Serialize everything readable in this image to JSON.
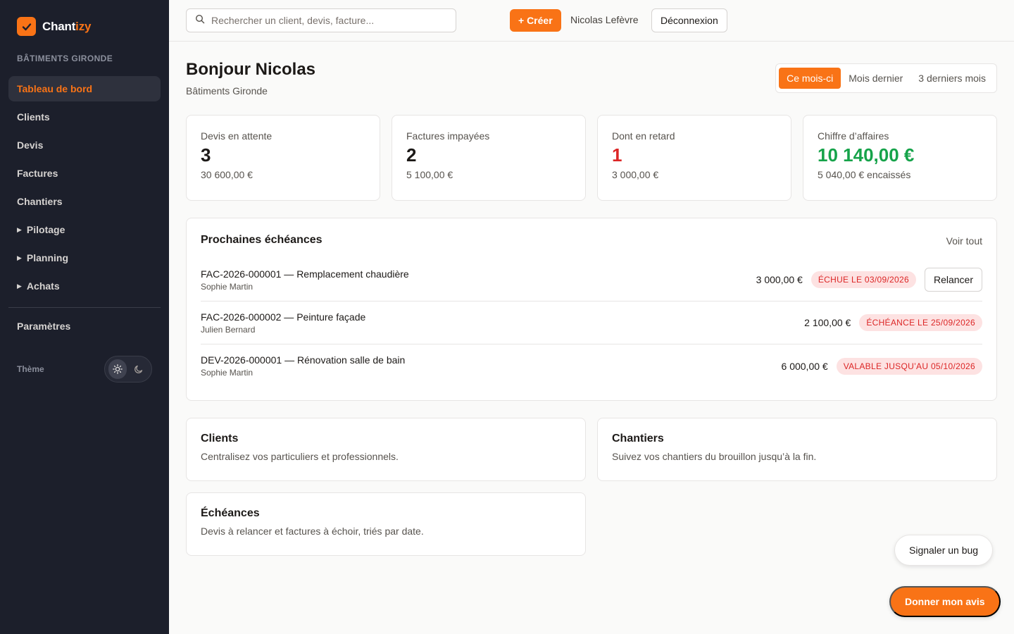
{
  "app": {
    "name_part1": "Chant",
    "name_part2": "izy",
    "brand_color": "#f97316"
  },
  "sidebar": {
    "company": "BÂTIMENTS GIRONDE",
    "items": [
      {
        "label": "Tableau de bord",
        "active": true
      },
      {
        "label": "Clients"
      },
      {
        "label": "Devis"
      },
      {
        "label": "Factures"
      },
      {
        "label": "Chantiers"
      },
      {
        "label": "Pilotage",
        "expandable": true
      },
      {
        "label": "Planning",
        "expandable": true
      },
      {
        "label": "Achats",
        "expandable": true
      }
    ],
    "settings_label": "Paramètres",
    "theme_label": "Thème",
    "theme_options": [
      "sun-icon",
      "moon-icon"
    ]
  },
  "topbar": {
    "search_placeholder": "Rechercher un client, devis, facture...",
    "create_label": "+ Créer",
    "user_name": "Nicolas Lefèvre",
    "logout_label": "Déconnexion"
  },
  "header": {
    "greeting": "Bonjour Nicolas",
    "subtitle": "Bâtiments Gironde",
    "periods": [
      "Ce mois-ci",
      "Mois dernier",
      "3 derniers mois"
    ],
    "active_period": "Ce mois-ci"
  },
  "kpis": [
    {
      "label": "Devis en attente",
      "value": "3",
      "sub": "30 600,00 €"
    },
    {
      "label": "Factures impayées",
      "value": "2",
      "sub": "5 100,00 €"
    },
    {
      "label": "Dont en retard",
      "value": "1",
      "sub": "3 000,00 €",
      "color": "#dc2626"
    },
    {
      "label": "Chiffre d’affaires",
      "value": "10 140,00 €",
      "sub": "5 040,00 € encaissés",
      "color": "#16a34a"
    }
  ],
  "deadlines": {
    "title": "Prochaines échéances",
    "see_all": "Voir tout",
    "rows": [
      {
        "title": "FAC-2026-000001 — Remplacement chaudière",
        "client": "Sophie Martin",
        "amount": "3 000,00 €",
        "badge": "ÉCHUE LE 03/09/2026",
        "action": "Relancer"
      },
      {
        "title": "FAC-2026-000002 — Peinture façade",
        "client": "Julien Bernard",
        "amount": "2 100,00 €",
        "badge": "ÉCHÉANCE LE 25/09/2026"
      },
      {
        "title": "DEV-2026-000001 — Rénovation salle de bain",
        "client": "Sophie Martin",
        "amount": "6 000,00 €",
        "badge": "VALABLE JUSQU’AU 05/10/2026"
      }
    ]
  },
  "cards": [
    {
      "title": "Clients",
      "desc": "Centralisez vos particuliers et professionnels."
    },
    {
      "title": "Chantiers",
      "desc": "Suivez vos chantiers du brouillon jusqu’à la fin."
    },
    {
      "title": "Échéances",
      "desc": "Devis à relancer et factures à échoir, triés par date."
    }
  ],
  "floating": {
    "bug_label": "Signaler un bug",
    "feedback_label": "Donner mon avis"
  }
}
